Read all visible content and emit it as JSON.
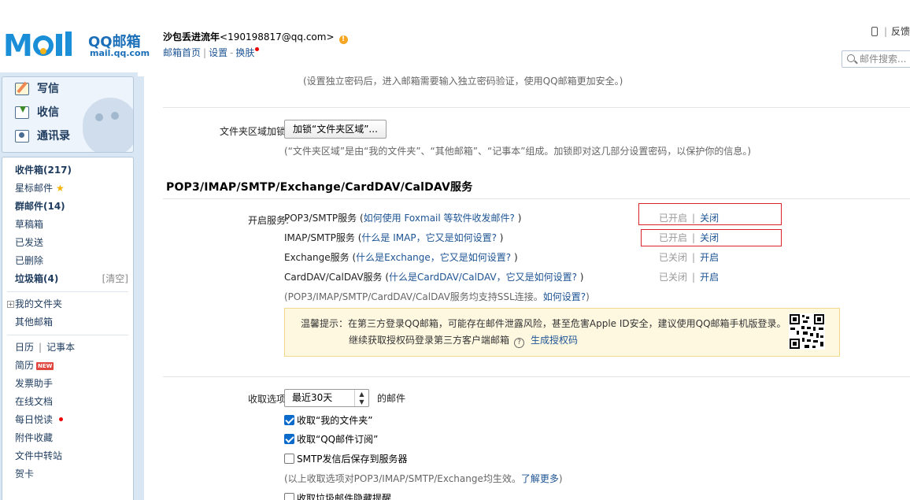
{
  "header": {
    "logo_text": "QQ邮箱",
    "logo_sub": "mail.qq.com",
    "user_name": "沙包丢进流年",
    "user_email": "<190198817@qq.com>",
    "warn_glyph": "!",
    "links": [
      "邮箱首页",
      "设置",
      "换肤"
    ],
    "right_text": "反馈",
    "search_placeholder": "邮件搜索..."
  },
  "actions": [
    {
      "label": "写信"
    },
    {
      "label": "收信"
    },
    {
      "label": "通讯录"
    }
  ],
  "folders": {
    "inbox": "收件箱(217)",
    "starred": "星标邮件",
    "star_glyph": "★",
    "group": "群邮件(14)",
    "drafts": "草稿箱",
    "sent": "已发送",
    "deleted": "已删除",
    "spam": "垃圾箱(4)",
    "spam_clean": "[清空]",
    "plus_glyph": "+",
    "my_folders": "我的文件夹",
    "other_mail": "其他邮箱",
    "calendar": "日历",
    "notebook": "记事本",
    "resume": "简历",
    "new_badge": "NEW",
    "send_helper": "发票助手",
    "online_docs": "在线文档",
    "daily": "每日悦读",
    "attachments": "附件收藏",
    "file_transfer": "文件中转站",
    "cards": "贺卡"
  },
  "settings": {
    "top_hint": "(设置独立密码后，进入邮箱需要输入独立密码验证，使用QQ邮箱更加安全。)",
    "folder_lock_label": "文件夹区域加锁:",
    "folder_lock_button": "加锁“文件夹区域”...",
    "folder_lock_note": "(“文件夹区域”是由“我的文件夹”、“其他邮箱”、“记事本”组成。加锁即对这几部分设置密码，以保护你的信息。)",
    "section_title": "POP3/IMAP/SMTP/Exchange/CardDAV/CalDAV服务",
    "enable_label": "开启服务:",
    "services": [
      {
        "name": "POP3/SMTP服务",
        "paren_open": " (",
        "link": "如何使用 Foxmail 等软件收发邮件?",
        "paren_close": " )",
        "status": "已开启",
        "action": "关闭"
      },
      {
        "name": "IMAP/SMTP服务",
        "paren_open": " (",
        "link": "什么是 IMAP，它又是如何设置?",
        "paren_close": " )",
        "status": "已开启",
        "action": "关闭"
      },
      {
        "name": "Exchange服务",
        "paren_open": " (",
        "link": "什么是Exchange，它又是如何设置?",
        "paren_close": " )",
        "status": "已关闭",
        "action": "开启"
      },
      {
        "name": "CardDAV/CalDAV服务",
        "paren_open": " (",
        "link": "什么是CardDAV/CalDAV，它又是如何设置?",
        "paren_close": " )",
        "status": "已关闭",
        "action": "开启"
      }
    ],
    "ssl_note_prefix": "(POP3/IMAP/SMTP/CardDAV/CalDAV服务均支持SSL连接。",
    "ssl_note_link": "如何设置?",
    "ssl_note_suffix": ")",
    "tip_line1": "温馨提示：在第三方登录QQ邮箱，可能存在邮件泄露风险，甚至危害Apple ID安全，建议使用QQ邮箱手机版登录。",
    "tip_line2": "继续获取授权码登录第三方客户端邮箱",
    "tip_q": "?",
    "tip_link": "生成授权码",
    "receive_label": "收取选项:",
    "receive_select": "最近30天",
    "receive_suffix": "的邮件",
    "checkboxes": [
      {
        "label": "收取“我的文件夹”",
        "checked": true
      },
      {
        "label": "收取“QQ邮件订阅”",
        "checked": true
      },
      {
        "label": "SMTP发信后保存到服务器",
        "checked": false
      }
    ],
    "receive_note_prefix": "(以上收取选项对POP3/IMAP/SMTP/Exchange均生效。",
    "receive_note_link": "了解更多",
    "receive_note_suffix": ")",
    "last_checkbox": "收取垃圾邮件隐藏提醒"
  },
  "colors": {
    "link": "#1e5494",
    "accent_red": "#d9222a",
    "sidebar_bg": "#d9e6f3",
    "tip_bg": "#fff8e1"
  }
}
